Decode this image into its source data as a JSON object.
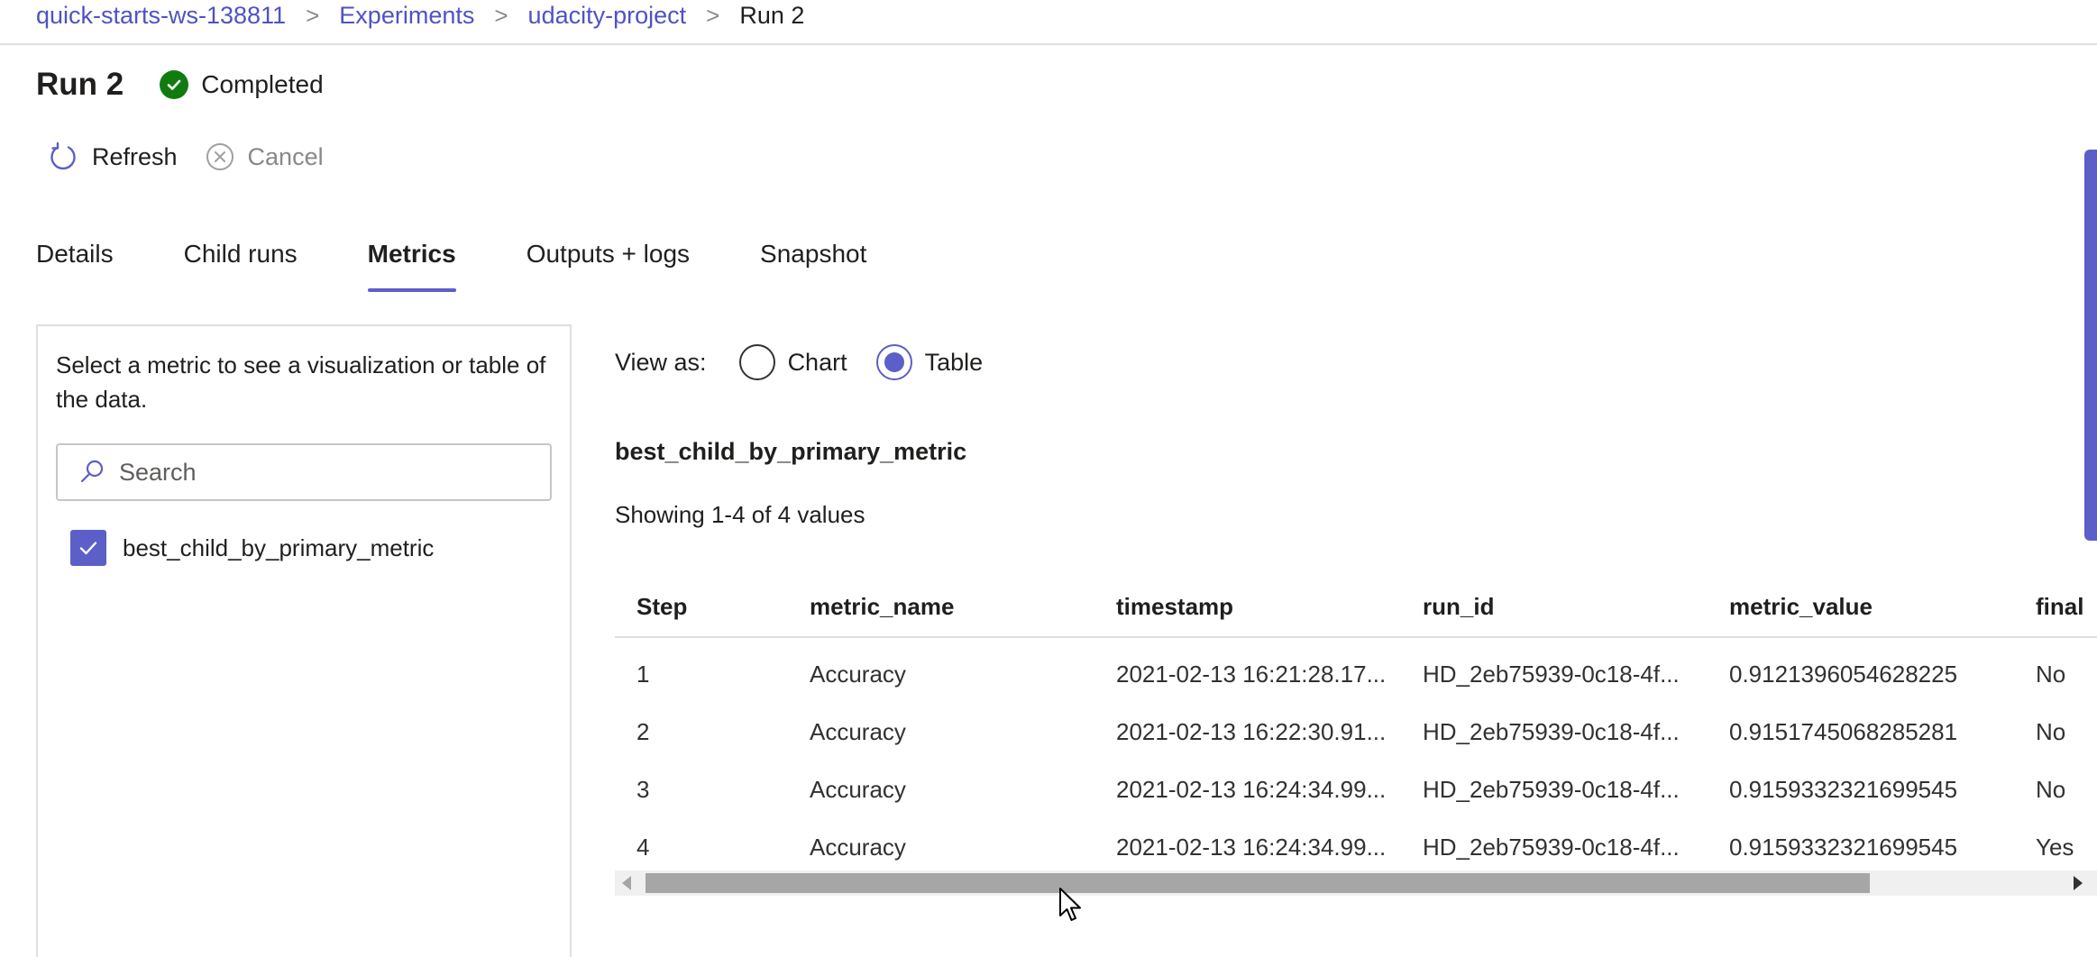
{
  "breadcrumb": {
    "items": [
      "quick-starts-ws-138811",
      "Experiments",
      "udacity-project"
    ],
    "current": "Run 2",
    "separator": ">"
  },
  "header": {
    "title": "Run 2",
    "status": "Completed"
  },
  "toolbar": {
    "refresh_label": "Refresh",
    "cancel_label": "Cancel"
  },
  "tabs": [
    {
      "label": "Details",
      "active": false
    },
    {
      "label": "Child runs",
      "active": false
    },
    {
      "label": "Metrics",
      "active": true
    },
    {
      "label": "Outputs + logs",
      "active": false
    },
    {
      "label": "Snapshot",
      "active": false
    }
  ],
  "left_panel": {
    "hint": "Select a metric to see a visualization or table of the data.",
    "search_placeholder": "Search",
    "metrics": [
      {
        "label": "best_child_by_primary_metric",
        "checked": true
      }
    ]
  },
  "view_as": {
    "label": "View as:",
    "options": [
      {
        "label": "Chart",
        "selected": false
      },
      {
        "label": "Table",
        "selected": true
      }
    ]
  },
  "metric_table": {
    "title": "best_child_by_primary_metric",
    "showing": "Showing 1-4 of 4 values",
    "columns": [
      "Step",
      "metric_name",
      "timestamp",
      "run_id",
      "metric_value",
      "final"
    ],
    "rows": [
      [
        "1",
        "Accuracy",
        "2021-02-13 16:21:28.17...",
        "HD_2eb75939-0c18-4f...",
        "0.9121396054628225",
        "No"
      ],
      [
        "2",
        "Accuracy",
        "2021-02-13 16:22:30.91...",
        "HD_2eb75939-0c18-4f...",
        "0.9151745068285281",
        "No"
      ],
      [
        "3",
        "Accuracy",
        "2021-02-13 16:24:34.99...",
        "HD_2eb75939-0c18-4f...",
        "0.9159332321699545",
        "No"
      ],
      [
        "4",
        "Accuracy",
        "2021-02-13 16:24:34.99...",
        "HD_2eb75939-0c18-4f...",
        "0.9159332321699545",
        "Yes"
      ]
    ]
  },
  "colors": {
    "accent": "#5b5fc7",
    "link": "#4f52c4",
    "success": "#107c10"
  }
}
